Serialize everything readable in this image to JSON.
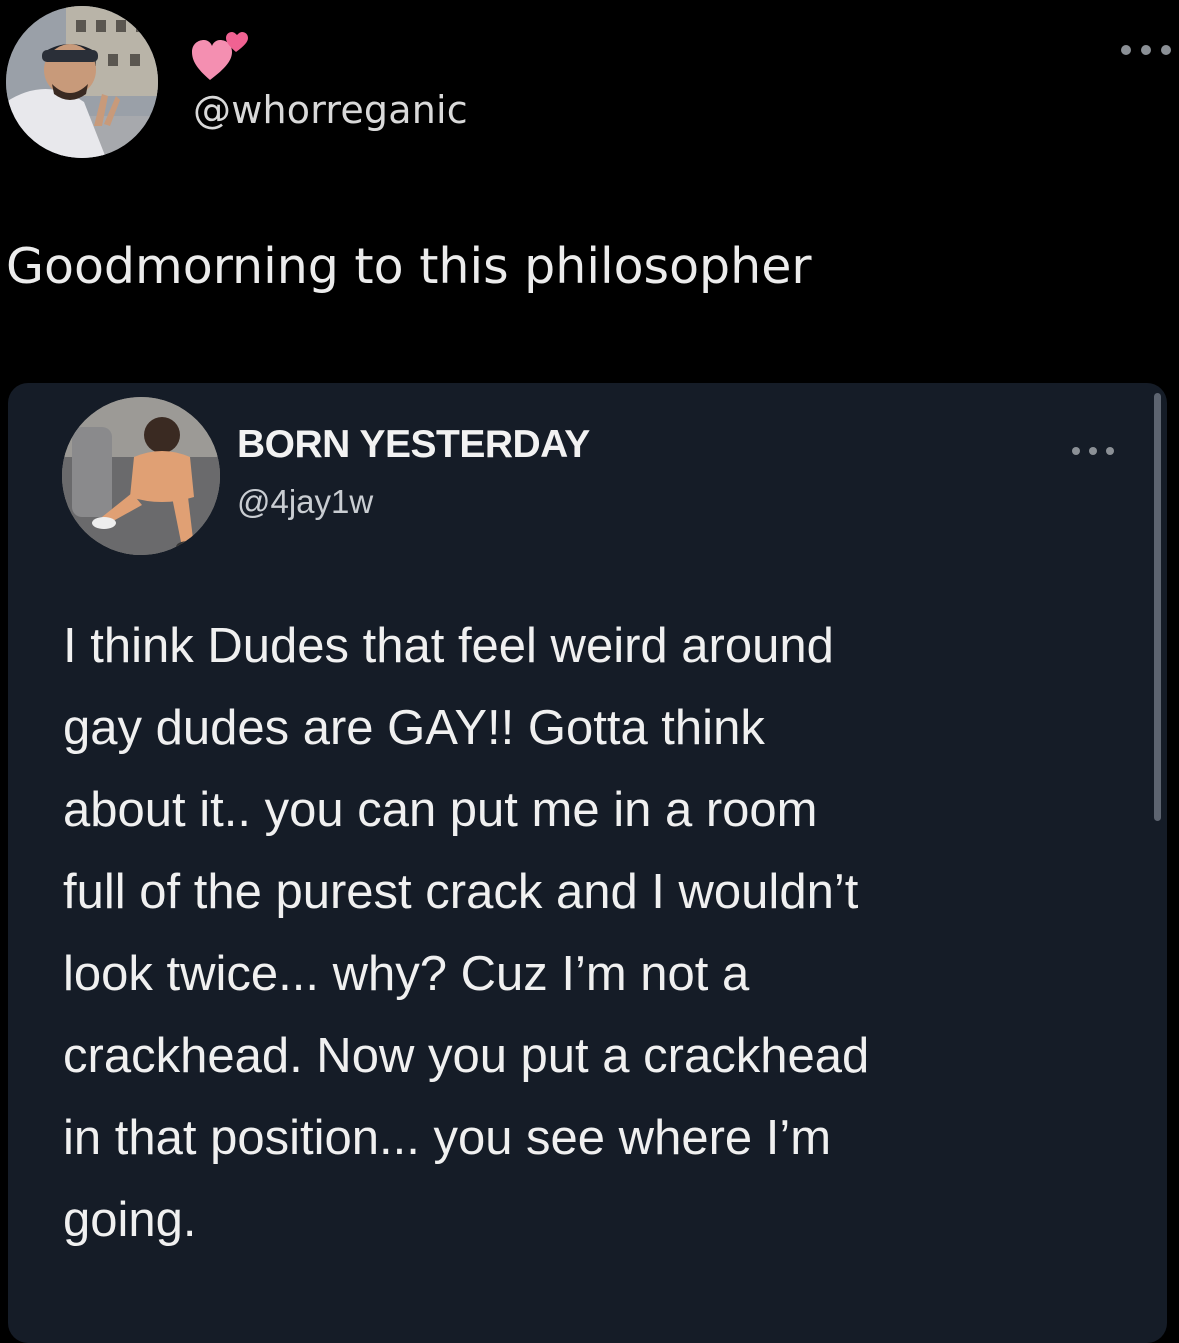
{
  "outer_tweet": {
    "handle": "@whorreganic",
    "text": "Goodmorning to this philosopher",
    "heart_icon": "pink-two-hearts-icon",
    "more_icon": "more-dots-icon"
  },
  "quoted_tweet": {
    "display_name": "BORN YESTERDAY",
    "handle": "@4jay1w",
    "more_icon": "more-dots-icon",
    "lines": [
      "I think Dudes that feel weird around",
      "gay dudes are GAY!! Gotta think",
      "about it.. you can put me  in a room",
      "full of the purest crack and I wouldn’t",
      "look twice... why? Cuz I’m not a",
      "crackhead. Now you put a crackhead",
      "in that position... you see where I’m",
      "going."
    ]
  },
  "colors": {
    "background": "#000000",
    "card_background": "#151c27",
    "text": "#f0f0f0",
    "heart": "#f48fb1"
  }
}
